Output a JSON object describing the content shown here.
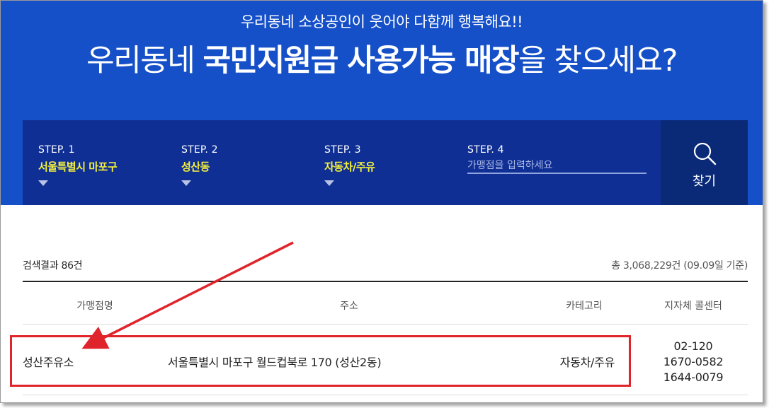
{
  "hero": {
    "subtitle": "우리동네 소상공인이 웃어야 다함께 행복해요!!",
    "title_prefix": "우리동네",
    "title_bold": "국민지원금 사용가능 매장",
    "title_suffix": "을 찾으세요?"
  },
  "steps": [
    {
      "label": "STEP. 1",
      "value": "서울특별시 마포구"
    },
    {
      "label": "STEP. 2",
      "value": "성산동"
    },
    {
      "label": "STEP. 3",
      "value": "자동차/주유"
    },
    {
      "label": "STEP. 4",
      "placeholder": "가맹점을 입력하세요"
    }
  ],
  "search": {
    "label": "찾기",
    "icon": "search-icon"
  },
  "results": {
    "count": "검색결과 86건",
    "total": "총 3,068,229건 (09.09일 기준)"
  },
  "table": {
    "headers": [
      "가맹점명",
      "주소",
      "카테고리",
      "지자체 콜센터"
    ],
    "rows": [
      {
        "name": "성산주유소",
        "address": "서울특별시 마포구 월드컵북로 170 (성산2동)",
        "category": "자동차/주유",
        "callcenter": [
          "02-120",
          "1670-0582",
          "1644-0079"
        ]
      }
    ]
  },
  "annotation": {
    "color": "#e0242b"
  },
  "colors": {
    "hero_bg": "#1650c8",
    "stepbar_bg": "#0f2f94",
    "search_bg": "#0a2a78",
    "step_value": "#f5f13c"
  }
}
